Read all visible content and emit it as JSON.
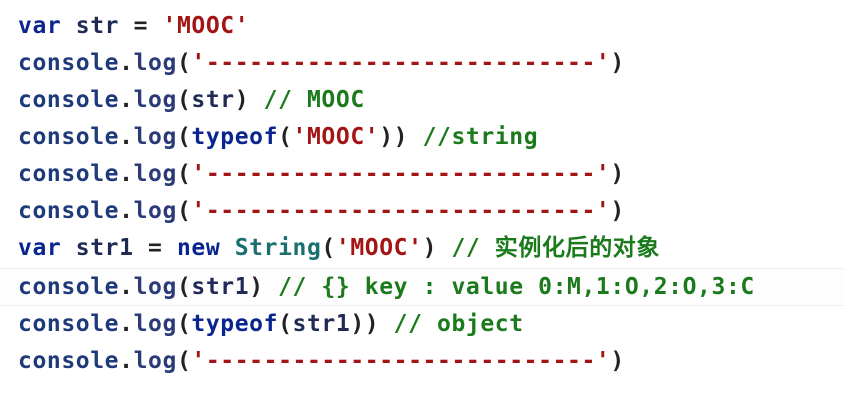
{
  "lines": [
    [
      {
        "text": "var",
        "cls": "tok-keyword"
      },
      {
        "text": " str ",
        "cls": "tok-ident"
      },
      {
        "text": "=",
        "cls": "tok-punct"
      },
      {
        "text": " ",
        "cls": "tok-punct"
      },
      {
        "text": "'MOOC'",
        "cls": "tok-string"
      }
    ],
    [
      {
        "text": "console",
        "cls": "tok-obj"
      },
      {
        "text": ".",
        "cls": "tok-punct"
      },
      {
        "text": "log",
        "cls": "tok-func"
      },
      {
        "text": "(",
        "cls": "tok-punct"
      },
      {
        "text": "'---------------------------'",
        "cls": "tok-string"
      },
      {
        "text": ")",
        "cls": "tok-punct"
      }
    ],
    [
      {
        "text": "console",
        "cls": "tok-obj"
      },
      {
        "text": ".",
        "cls": "tok-punct"
      },
      {
        "text": "log",
        "cls": "tok-func"
      },
      {
        "text": "(",
        "cls": "tok-punct"
      },
      {
        "text": "str",
        "cls": "tok-ident"
      },
      {
        "text": ") ",
        "cls": "tok-punct"
      },
      {
        "text": "// MOOC",
        "cls": "tok-comment"
      }
    ],
    [
      {
        "text": "console",
        "cls": "tok-obj"
      },
      {
        "text": ".",
        "cls": "tok-punct"
      },
      {
        "text": "log",
        "cls": "tok-func"
      },
      {
        "text": "(",
        "cls": "tok-punct"
      },
      {
        "text": "typeof",
        "cls": "tok-keyword"
      },
      {
        "text": "(",
        "cls": "tok-punct"
      },
      {
        "text": "'MOOC'",
        "cls": "tok-string"
      },
      {
        "text": ")) ",
        "cls": "tok-punct"
      },
      {
        "text": "//string",
        "cls": "tok-comment"
      }
    ],
    [
      {
        "text": "console",
        "cls": "tok-obj"
      },
      {
        "text": ".",
        "cls": "tok-punct"
      },
      {
        "text": "log",
        "cls": "tok-func"
      },
      {
        "text": "(",
        "cls": "tok-punct"
      },
      {
        "text": "'---------------------------'",
        "cls": "tok-string"
      },
      {
        "text": ")",
        "cls": "tok-punct"
      }
    ],
    [
      {
        "text": "console",
        "cls": "tok-obj"
      },
      {
        "text": ".",
        "cls": "tok-punct"
      },
      {
        "text": "log",
        "cls": "tok-func"
      },
      {
        "text": "(",
        "cls": "tok-punct"
      },
      {
        "text": "'---------------------------'",
        "cls": "tok-string"
      },
      {
        "text": ")",
        "cls": "tok-punct"
      }
    ],
    [
      {
        "text": "var",
        "cls": "tok-keyword"
      },
      {
        "text": " str1 ",
        "cls": "tok-ident"
      },
      {
        "text": "=",
        "cls": "tok-punct"
      },
      {
        "text": " ",
        "cls": "tok-punct"
      },
      {
        "text": "new",
        "cls": "tok-keyword"
      },
      {
        "text": " ",
        "cls": "tok-punct"
      },
      {
        "text": "String",
        "cls": "tok-type"
      },
      {
        "text": "(",
        "cls": "tok-punct"
      },
      {
        "text": "'MOOC'",
        "cls": "tok-string"
      },
      {
        "text": ") ",
        "cls": "tok-punct"
      },
      {
        "text": "// 实例化后的对象",
        "cls": "tok-comment"
      }
    ],
    [
      {
        "text": "console",
        "cls": "tok-obj"
      },
      {
        "text": ".",
        "cls": "tok-punct"
      },
      {
        "text": "log",
        "cls": "tok-func"
      },
      {
        "text": "(",
        "cls": "tok-punct"
      },
      {
        "text": "str1",
        "cls": "tok-ident"
      },
      {
        "text": ") ",
        "cls": "tok-punct"
      },
      {
        "text": "// {} key : value 0:M,1:O,2:O,3:C",
        "cls": "tok-comment"
      }
    ],
    [
      {
        "text": "console",
        "cls": "tok-obj"
      },
      {
        "text": ".",
        "cls": "tok-punct"
      },
      {
        "text": "log",
        "cls": "tok-func"
      },
      {
        "text": "(",
        "cls": "tok-punct"
      },
      {
        "text": "typeof",
        "cls": "tok-keyword"
      },
      {
        "text": "(",
        "cls": "tok-punct"
      },
      {
        "text": "str1",
        "cls": "tok-ident"
      },
      {
        "text": ")) ",
        "cls": "tok-punct"
      },
      {
        "text": "// object",
        "cls": "tok-comment"
      }
    ],
    [
      {
        "text": "console",
        "cls": "tok-obj"
      },
      {
        "text": ".",
        "cls": "tok-punct"
      },
      {
        "text": "log",
        "cls": "tok-func"
      },
      {
        "text": "(",
        "cls": "tok-punct"
      },
      {
        "text": "'---------------------------'",
        "cls": "tok-string"
      },
      {
        "text": ")",
        "cls": "tok-punct"
      }
    ]
  ],
  "colors": {
    "keyword": "#0b2590",
    "string": "#a31515",
    "comment": "#1b7a1b",
    "type": "#1a6f6f",
    "background": "#ffffff"
  }
}
